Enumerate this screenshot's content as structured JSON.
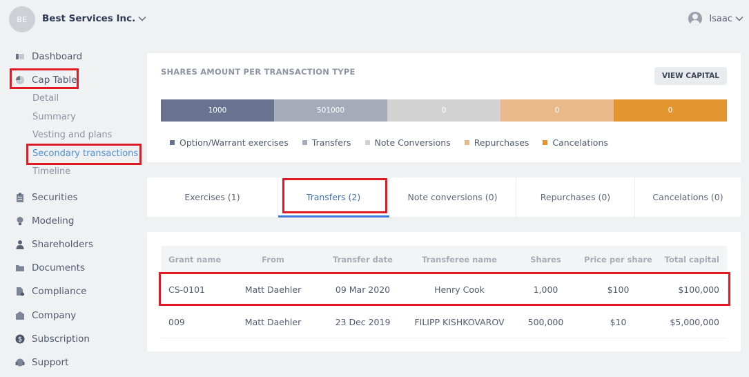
{
  "header": {
    "avatar_initials": "BE",
    "company": "Best Services Inc.",
    "user": "Isaac"
  },
  "sidebar": {
    "items": [
      {
        "label": "Dashboard",
        "icon": "dashboard-icon"
      },
      {
        "label": "Cap Table",
        "icon": "pie-chart-icon"
      },
      {
        "label": "Securities",
        "icon": "clipboard-icon"
      },
      {
        "label": "Modeling",
        "icon": "lightbulb-icon"
      },
      {
        "label": "Shareholders",
        "icon": "person-icon"
      },
      {
        "label": "Documents",
        "icon": "folder-icon"
      },
      {
        "label": "Compliance",
        "icon": "file-check-icon"
      },
      {
        "label": "Company",
        "icon": "building-icon"
      },
      {
        "label": "Subscription",
        "icon": "dollar-icon"
      },
      {
        "label": "Support",
        "icon": "headset-icon"
      }
    ],
    "cap_table_sub": [
      "Detail",
      "Summary",
      "Vesting and plans",
      "Secondary transactions",
      "Timeline"
    ]
  },
  "shares_card": {
    "title": "SHARES AMOUNT PER TRANSACTION TYPE",
    "view_button": "VIEW CAPITAL",
    "segments": [
      {
        "label": "1000",
        "color": "#67738f"
      },
      {
        "label": "501000",
        "color": "#a5abb9"
      },
      {
        "label": "0",
        "color": "#d2d2d2"
      },
      {
        "label": "0",
        "color": "#e9b98c"
      },
      {
        "label": "0",
        "color": "#e3952f"
      }
    ],
    "legend": [
      {
        "label": "Option/Warrant exercises",
        "color": "#67738f"
      },
      {
        "label": "Transfers",
        "color": "#a5abb9"
      },
      {
        "label": "Note Conversions",
        "color": "#d2d2d2"
      },
      {
        "label": "Repurchases",
        "color": "#e9b98c"
      },
      {
        "label": "Cancelations",
        "color": "#e3952f"
      }
    ]
  },
  "tabs": [
    {
      "label": "Exercises (1)"
    },
    {
      "label": "Transfers (2)"
    },
    {
      "label": "Note conversions (0)"
    },
    {
      "label": "Repurchases (0)"
    },
    {
      "label": "Cancelations (0)"
    }
  ],
  "table": {
    "columns": [
      "Grant name",
      "From",
      "Transfer date",
      "Transferee name",
      "Shares",
      "Price per share",
      "Total capital"
    ],
    "rows": [
      [
        "CS-0101",
        "Matt Daehler",
        "09 Mar 2020",
        "Henry Cook",
        "1,000",
        "$100",
        "$100,000"
      ],
      [
        "009",
        "Matt Daehler",
        "23 Dec 2019",
        "FILIPP KISHKOVAROV",
        "500,000",
        "$10",
        "$5,000,000"
      ]
    ]
  },
  "colors": {
    "accent": "#3a7bd5",
    "highlight": "#e01b24"
  }
}
